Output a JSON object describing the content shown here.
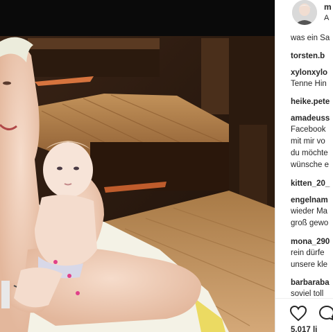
{
  "post": {
    "username": "m",
    "subtitle": "A",
    "caption_tail": "was ein Sa"
  },
  "comments": [
    {
      "user": "torsten.b",
      "lines": []
    },
    {
      "user": "xylonxylo",
      "lines": [
        "Tenne Hin"
      ]
    },
    {
      "user": "heike.pete",
      "lines": []
    },
    {
      "user": "amadeuss",
      "lines": [
        "Facebook",
        "mit mir vo",
        "du möchte",
        "wünsche e"
      ]
    },
    {
      "user": "kitten_20_",
      "lines": []
    },
    {
      "user": "engelnam",
      "lines": [
        "wieder Ma",
        "groß gewo"
      ]
    },
    {
      "user": "mona_290",
      "lines": [
        "rein dürfe",
        "unsere kle"
      ]
    },
    {
      "user": "barbaraba",
      "lines": [
        "soviel toll"
      ]
    }
  ],
  "actions": {
    "like_icon": "heart-icon",
    "comment_icon": "comment-icon"
  },
  "likes_text": "5.017 li"
}
